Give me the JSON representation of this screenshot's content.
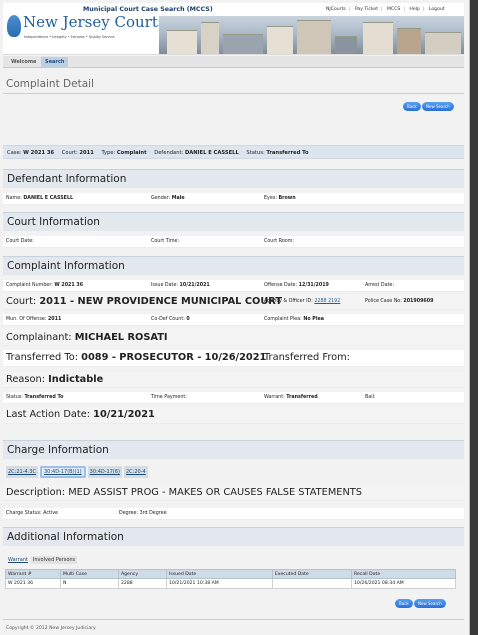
{
  "header": {
    "title": "Municipal Court Case Search (MCCS)",
    "logo_text": "New Jersey Courts",
    "tagline": "Independence • Integrity • Fairness • Quality Service",
    "links": [
      "NJCourts",
      "Pay Ticket",
      "MCCS",
      "Help",
      "Logout"
    ]
  },
  "nav": {
    "tabs": [
      "Welcome",
      "Search"
    ],
    "active": "Search"
  },
  "page": {
    "title": "Complaint Detail"
  },
  "buttons": {
    "back": "Back",
    "new_search": "New Search"
  },
  "summary": {
    "case_label": "Case:",
    "case": "W 2021 36",
    "court_label": "Court:",
    "court": "2011",
    "type_label": "Type:",
    "type": "Complaint",
    "defendant_label": "Defendant:",
    "defendant": "DANIEL E CASSELL",
    "status_label": "Status:",
    "status": "Transferred To"
  },
  "defendant": {
    "heading": "Defendant Information",
    "name_label": "Name:",
    "name": "DANIEL E CASSELL",
    "gender_label": "Gender:",
    "gender": "Male",
    "eyes_label": "Eyes:",
    "eyes": "Brown"
  },
  "court": {
    "heading": "Court Information",
    "date_label": "Court Date:",
    "time_label": "Court Time:",
    "room_label": "Court Room:"
  },
  "complaint": {
    "heading": "Complaint Information",
    "number_label": "Complaint Number:",
    "number": "W 2021 36",
    "issue_label": "Issue Date:",
    "issue": "10/21/2021",
    "offense_label": "Offense Date:",
    "offense": "12/31/2019",
    "arrest_label": "Arrest Date:",
    "court_label": "Court:",
    "court": "2011 - NEW PROVIDENCE MUNICIPAL COURT",
    "agency_label": "Agency & Officer ID:",
    "agency": "2288 2192",
    "police_label": "Police Case No:",
    "police": "201909609",
    "muni_label": "Mun. Of Offense:",
    "muni": "2011",
    "codef_label": "Co-Def Count:",
    "codef": "0",
    "plea_label": "Complaint Plea:",
    "plea": "No Plea",
    "complainant_label": "Complainant:",
    "complainant": "MICHAEL ROSATI",
    "transferred_to_label": "Transferred To:",
    "transferred_to": "0089 - PROSECUTOR - 10/26/2021",
    "transferred_from_label": "Transferred From:",
    "reason_label": "Reason:",
    "reason": "Indictable",
    "status_label": "Status:",
    "status": "Transferred To",
    "time_payment_label": "Time Payment:",
    "warrant_label": "Warrant:",
    "warrant": "Transferred",
    "bail_label": "Bail:",
    "last_action_label": "Last Action Date:",
    "last_action": "10/21/2021"
  },
  "charge": {
    "heading": "Charge Information",
    "tabs": [
      "2C:21-4.3C",
      "30:4D-17(B)(1)",
      "30:4D-17(6)",
      "2C:20-4"
    ],
    "active_tab": 1,
    "description_label": "Description:",
    "description": "MED ASSIST PROG - MAKES OR CAUSES FALSE STATEMENTS",
    "status_label": "Charge Status:",
    "status": "Active",
    "degree_label": "Degree:",
    "degree": "3rd Degree"
  },
  "additional": {
    "heading": "Additional Information",
    "tabs": [
      "Warrant",
      "Involved Persons"
    ],
    "active_tab": 1,
    "columns": [
      "Warrant #",
      "Multi Case",
      "Agency",
      "Issued Date",
      "Executed Date",
      "Recall Date"
    ],
    "rows": [
      [
        "W 2021 36",
        "N",
        "2288",
        "10/21/2021 10:38 AM",
        "",
        "10/26/2021 08:34 AM"
      ]
    ]
  },
  "footer": {
    "copyright": "Copyright © 2012 New Jersey Judiciary"
  }
}
